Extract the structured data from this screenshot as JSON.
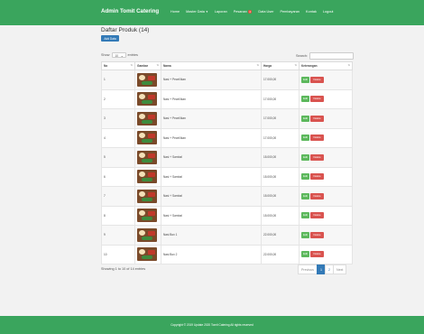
{
  "navbar": {
    "brand": "Admin Tomit Catering",
    "items": [
      {
        "label": "Home"
      },
      {
        "label": "Master Data"
      },
      {
        "label": "Laporan"
      },
      {
        "label": "Pesanan",
        "badge": "4"
      },
      {
        "label": "Data User"
      },
      {
        "label": "Pembayaran"
      },
      {
        "label": "Kontak"
      },
      {
        "label": "Logout"
      }
    ]
  },
  "page": {
    "title": "Daftar Produk (14)",
    "add_label": "Add Data"
  },
  "controls": {
    "show_label": "Show",
    "entries_value": "10",
    "entries_label": "entries",
    "search_label": "Search:"
  },
  "table": {
    "columns": [
      "No",
      "Gambar",
      "Nama",
      "Harga",
      "Keterangan"
    ],
    "rows": [
      {
        "no": "1",
        "nama": "Nasi + Pecel/Ikan",
        "harga": "17.000,00"
      },
      {
        "no": "2",
        "nama": "Nasi + Pecel/Ikan",
        "harga": "17.000,00"
      },
      {
        "no": "3",
        "nama": "Nasi + Pecel/Ikan",
        "harga": "17.000,00"
      },
      {
        "no": "4",
        "nama": "Nasi + Pecel/Ikan",
        "harga": "17.000,00"
      },
      {
        "no": "5",
        "nama": "Nasi + Sambal",
        "harga": "15.000,00"
      },
      {
        "no": "6",
        "nama": "Nasi + Sambal",
        "harga": "15.000,00"
      },
      {
        "no": "7",
        "nama": "Nasi + Sambal",
        "harga": "15.000,00"
      },
      {
        "no": "8",
        "nama": "Nasi + Sambal",
        "harga": "15.000,00"
      },
      {
        "no": "9",
        "nama": "Nasi Box 1",
        "harga": "22.000,00"
      },
      {
        "no": "10",
        "nama": "Nasi Box 2",
        "harga": "22.000,00"
      }
    ],
    "edit_label": "Edit",
    "delete_label": "Delete"
  },
  "pagination": {
    "info": "Showing 1 to 10 of 14 entries",
    "previous": "Previous",
    "pages": [
      "1",
      "2"
    ],
    "active_page": "1",
    "next": "Next"
  },
  "footer": {
    "text": "Copyright © 2019 Update 2020 Tomit Catering All rights reserved"
  },
  "colors": {
    "primary_green": "#3aa55d",
    "blue": "#337ab7",
    "edit_green": "#5cb85c",
    "delete_red": "#d9534f"
  }
}
